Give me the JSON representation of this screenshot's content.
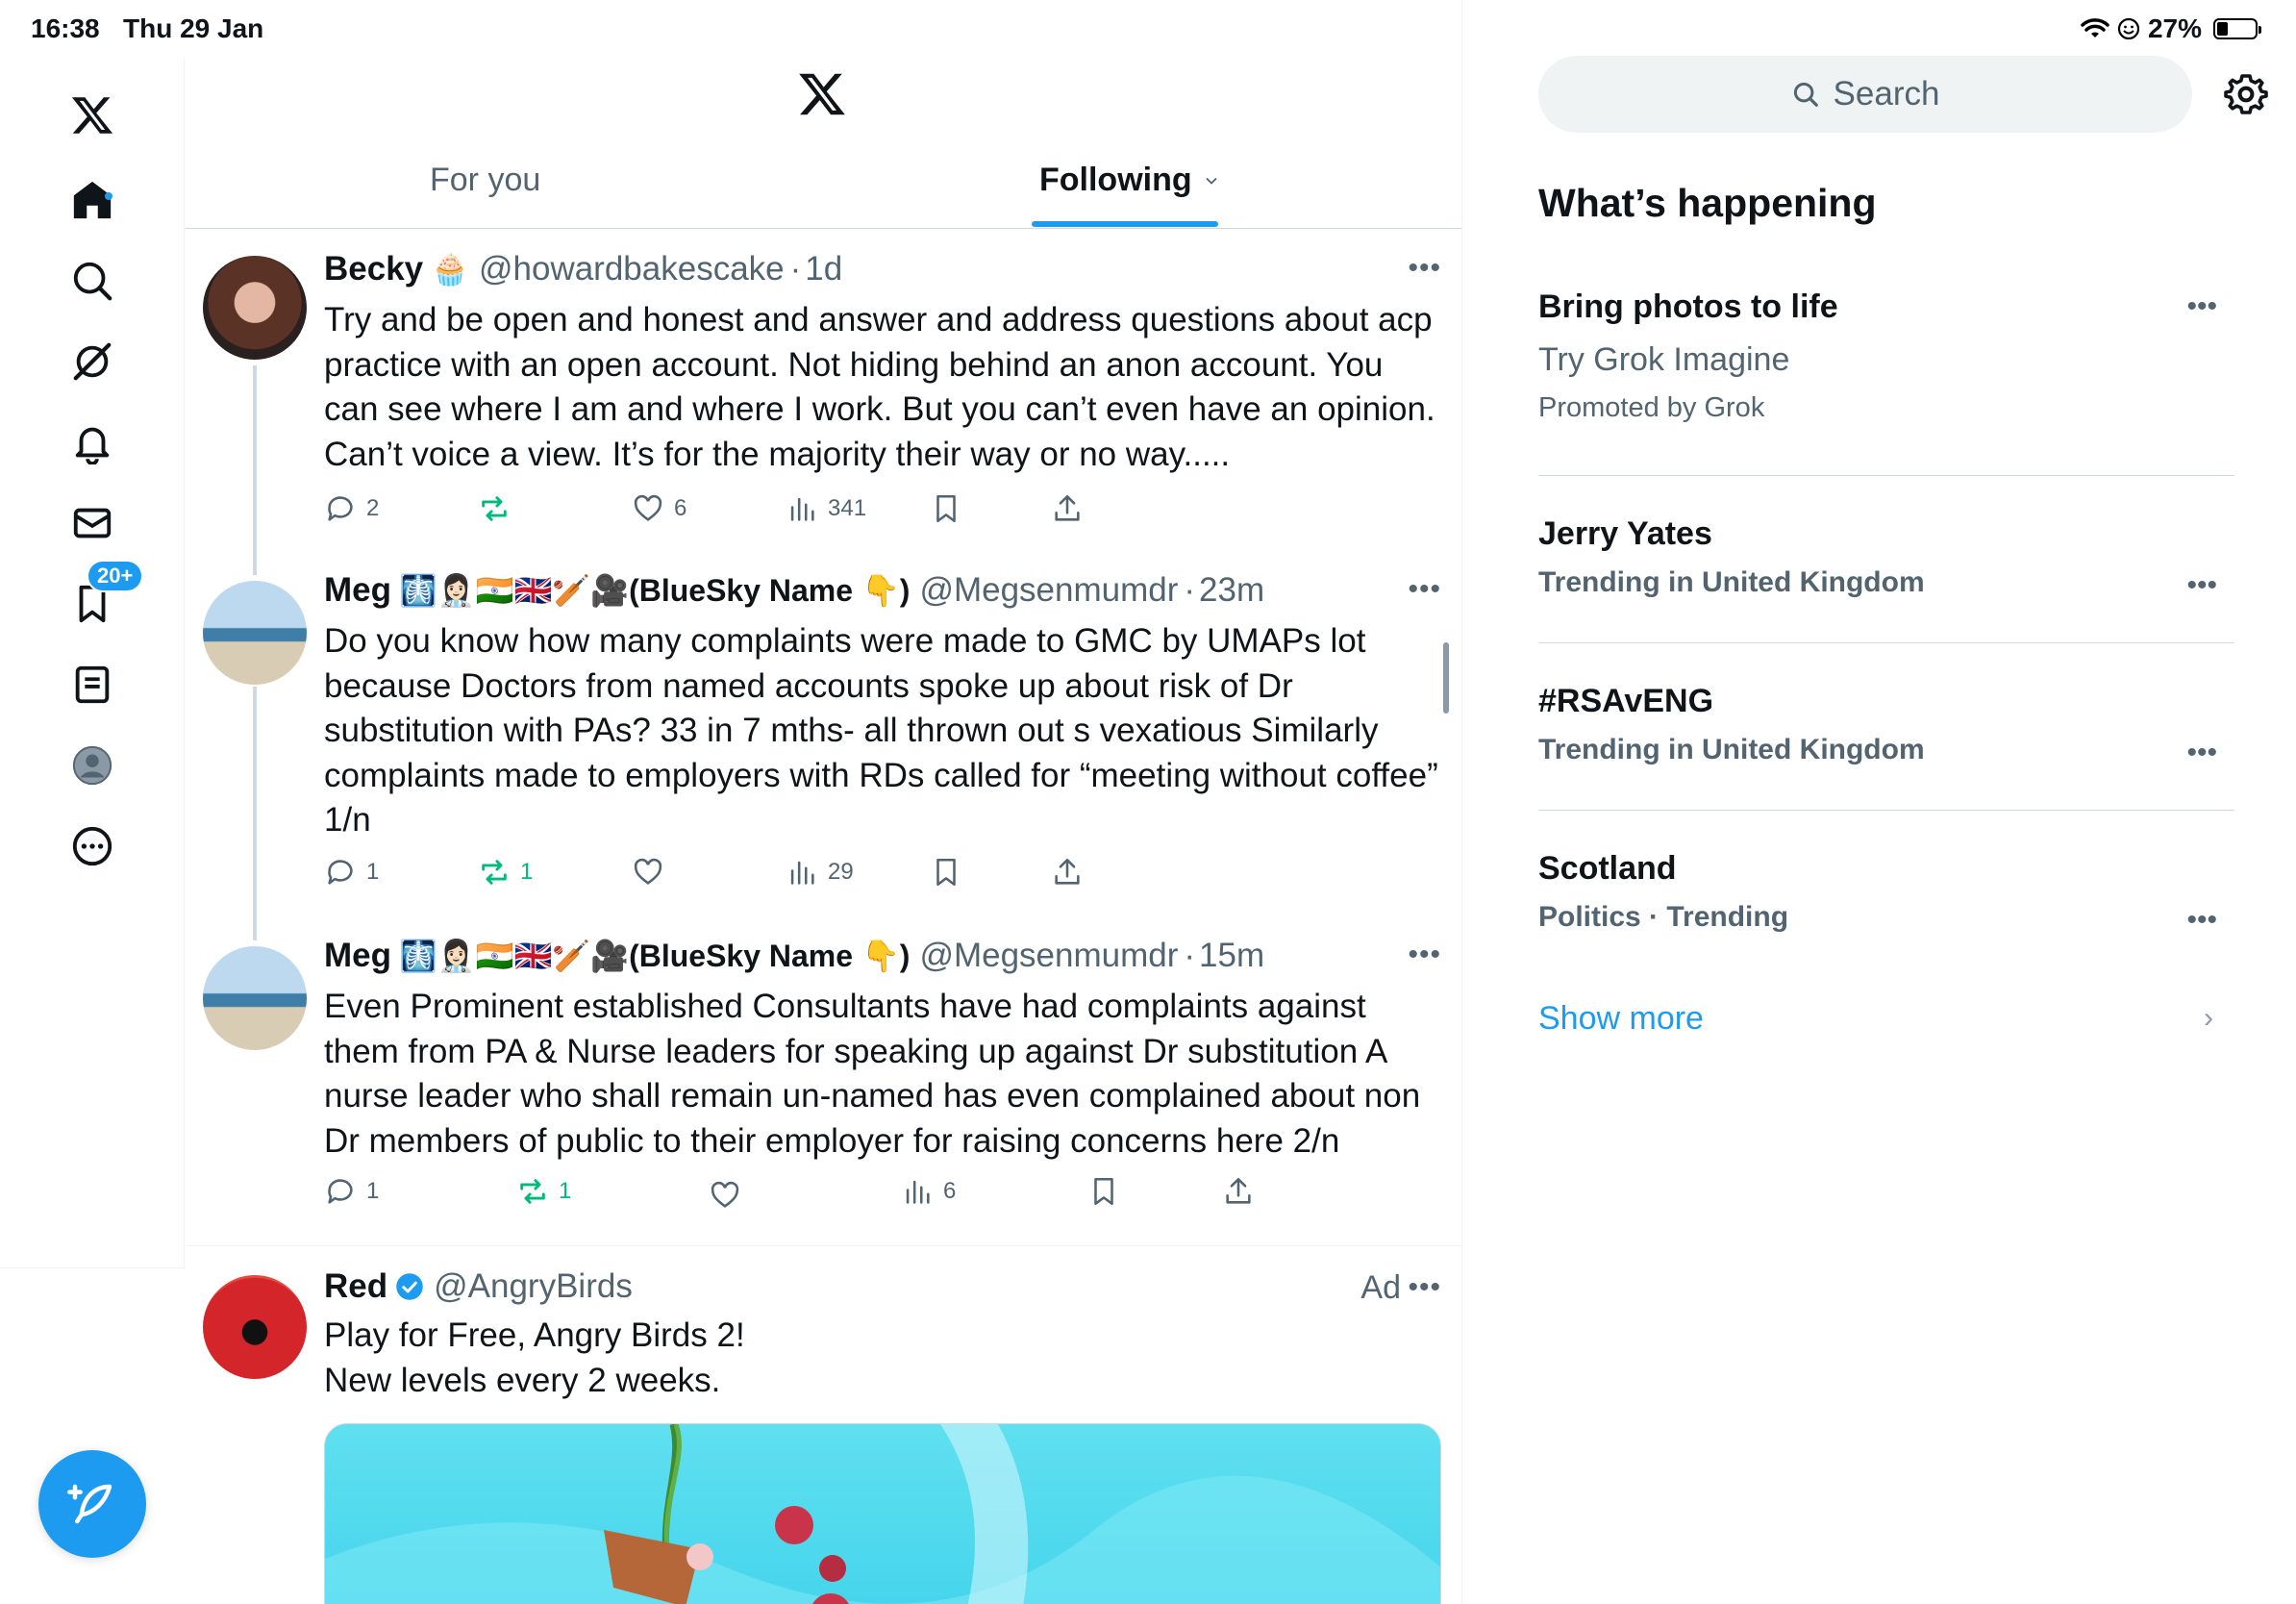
{
  "status_bar": {
    "time": "16:38",
    "date": "Thu 29 Jan",
    "battery": "27%",
    "battery_fraction": 0.27
  },
  "nav": {
    "items": [
      "x-logo",
      "home",
      "search",
      "grok",
      "notifications",
      "messages",
      "bookmarks",
      "lists",
      "profile",
      "more"
    ],
    "notifications_badge": "20+"
  },
  "tabs": {
    "for_you": "For you",
    "following": "Following"
  },
  "tweets": [
    {
      "name": "Becky",
      "emoji": "🧁",
      "handle": "@howardbakescake",
      "dot": "·",
      "time": "1d",
      "text": "Try and be open and honest and answer and address questions about acp practice with an open account. Not hiding behind an anon account. You can see where I am and where I work. But you can’t even have an opinion. Can’t voice a view. It’s for the majority their way or no way.....",
      "replies": "2",
      "reposts": "",
      "likes": "6",
      "views": "341"
    },
    {
      "name": "Meg",
      "emoji": "🩻👩🏻‍⚕️🇮🇳🇬🇧🏏🎥(BlueSky Name 👇)",
      "handle": "@Megsenmumdr",
      "dot": "·",
      "time": "23m",
      "text": "Do you know how many complaints were made to GMC by UMAPs lot because Doctors from named accounts spoke up about risk of Dr substitution with PAs? 33 in 7 mths- all thrown out s vexatious Similarly complaints made to employers with RDs called for “meeting without coffee” 1/n",
      "replies": "1",
      "reposts": "1",
      "likes": "",
      "views": "29"
    },
    {
      "name": "Meg",
      "emoji": "🩻👩🏻‍⚕️🇮🇳🇬🇧🏏🎥(BlueSky Name 👇)",
      "handle": "@Megsenmumdr",
      "dot": "·",
      "time": "15m",
      "text": "Even Prominent established Consultants have had complaints against them from PA & Nurse leaders for speaking up against Dr substitution A nurse leader who shall remain un-named has even complained about non Dr members of public to their employer for raising concerns here 2/n",
      "replies": "1",
      "reposts": "1",
      "likes": "",
      "views": "6"
    }
  ],
  "ad": {
    "name": "Red",
    "handle": "@AngryBirds",
    "label": "Ad",
    "line1": "Play for Free, Angry Birds 2!",
    "line2": "New levels every 2 weeks."
  },
  "sidebar": {
    "search_placeholder": "Search",
    "whats_happening": "What’s happening",
    "promo": {
      "title": "Bring photos to life",
      "subtitle": "Try Grok Imagine",
      "promoted": "Promoted by Grok"
    },
    "trends": [
      {
        "title": "Jerry Yates",
        "context": "Trending in United Kingdom"
      },
      {
        "title": "#RSAvENG",
        "context": "Trending in United Kingdom"
      },
      {
        "title": "Scotland",
        "context": "Politics · Trending"
      }
    ],
    "show_more": "Show more"
  },
  "colors": {
    "accent": "#1d9bf0",
    "repost_green": "#00ba7c",
    "secondary_text": "#536471"
  }
}
